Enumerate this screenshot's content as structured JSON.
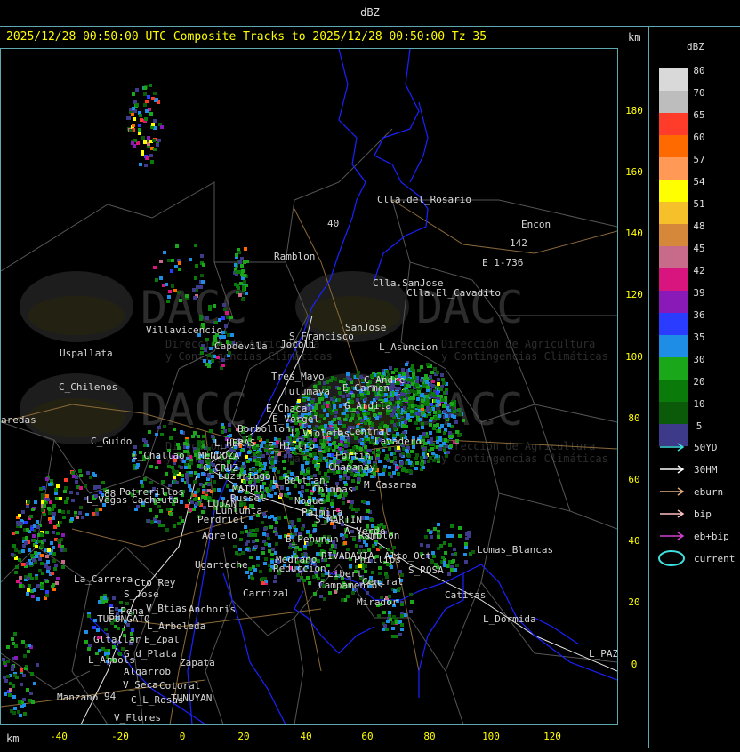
{
  "title": "dBZ",
  "header": "2025/12/28 00:50:00 UTC Composite Tracks to 2025/12/28 00:50:00 Tz 35",
  "km_label": "km",
  "colors": {
    "frame": "#5fa8b0",
    "header": "#ffff00",
    "border_blue": "#1a22ff",
    "roads": "#8a6a3a",
    "white_roads": "#e8e8e8"
  },
  "y_axis": {
    "ticks": [
      "180",
      "160",
      "140",
      "120",
      "100",
      "80",
      "60",
      "40",
      "20",
      "0"
    ]
  },
  "x_axis": {
    "ticks": [
      "-40",
      "-20",
      "0",
      "20",
      "40",
      "60",
      "80",
      "100",
      "120"
    ]
  },
  "legend": {
    "title": "dBZ",
    "scale": [
      {
        "label": "80",
        "color": "#d9d9d9"
      },
      {
        "label": "70",
        "color": "#bdbdbd"
      },
      {
        "label": "65",
        "color": "#ff3b2a"
      },
      {
        "label": "60",
        "color": "#ff6a00"
      },
      {
        "label": "57",
        "color": "#ff9955"
      },
      {
        "label": "54",
        "color": "#ffff00"
      },
      {
        "label": "51",
        "color": "#f6c02a"
      },
      {
        "label": "48",
        "color": "#d6883a"
      },
      {
        "label": "45",
        "color": "#c86b8a"
      },
      {
        "label": "42",
        "color": "#d8157e"
      },
      {
        "label": "39",
        "color": "#8a1ab8"
      },
      {
        "label": "36",
        "color": "#2a3cff"
      },
      {
        "label": "35",
        "color": "#1e8de6"
      },
      {
        "label": "30",
        "color": "#1aa81a"
      },
      {
        "label": "20",
        "color": "#0a7a0a"
      },
      {
        "label": "10",
        "color": "#0a5a0a"
      },
      {
        "label": "5",
        "color": "#3e3a8a"
      }
    ],
    "tracks": [
      {
        "label": "50YD",
        "color": "#40e0e0"
      },
      {
        "label": "30HM",
        "color": "#ffffff"
      },
      {
        "label": "eburn",
        "color": "#e0b080"
      },
      {
        "label": "bip",
        "color": "#ffc0c0"
      },
      {
        "label": "eb+bip",
        "color": "#d040d0"
      }
    ],
    "current_label": "current",
    "current_color": "#40e0e0"
  },
  "watermark": {
    "text": "DACC",
    "sub1": "Dirección de Agricultura",
    "sub2": "y Contingencias Climáticas"
  },
  "places": [
    {
      "name": "Clla.del_Rosario"
    },
    {
      "name": "Encon"
    },
    {
      "name": "142"
    },
    {
      "name": "E_1-736"
    },
    {
      "name": "Ramblon"
    },
    {
      "name": "40"
    },
    {
      "name": "Clla.SanJose"
    },
    {
      "name": "Clla.El_Cavadito"
    },
    {
      "name": "Villavicencio"
    },
    {
      "name": "Capdevila"
    },
    {
      "name": "S_Francisco"
    },
    {
      "name": "SanJose"
    },
    {
      "name": "Jocoli"
    },
    {
      "name": "L_Asuncion"
    },
    {
      "name": "Uspallata"
    },
    {
      "name": "Tres_Mayo"
    },
    {
      "name": "C_Andre"
    },
    {
      "name": "Tulumaya"
    },
    {
      "name": "E_Carmen"
    },
    {
      "name": "C_Chilenos"
    },
    {
      "name": "E_Chacal"
    },
    {
      "name": "E_Vergel"
    },
    {
      "name": "G_Ardila"
    },
    {
      "name": "aredas"
    },
    {
      "name": "Borbollon"
    },
    {
      "name": "L_Violetas"
    },
    {
      "name": "E_Central"
    },
    {
      "name": "C_Guido"
    },
    {
      "name": "L_HERAS"
    },
    {
      "name": "E_Hiltro"
    },
    {
      "name": "Lavadero"
    },
    {
      "name": "E_Challao"
    },
    {
      "name": "MENDOZA"
    },
    {
      "name": "Fortin"
    },
    {
      "name": "G_CRUZ"
    },
    {
      "name": "Luzuriaga"
    },
    {
      "name": "Chapanay"
    },
    {
      "name": "L_Beltran"
    },
    {
      "name": "M_Casarea"
    },
    {
      "name": "Potrerillos"
    },
    {
      "name": "MAIPU"
    },
    {
      "name": "Chimbas"
    },
    {
      "name": "L_Vegas"
    },
    {
      "name": "Cacheuta"
    },
    {
      "name": "Russel"
    },
    {
      "name": "Nogue"
    },
    {
      "name": "LUJAN"
    },
    {
      "name": "Lunlunta"
    },
    {
      "name": "Palmira"
    },
    {
      "name": "Perdriel"
    },
    {
      "name": "S_MARTIN"
    },
    {
      "name": "A_Verde"
    },
    {
      "name": "Agrelo"
    },
    {
      "name": "Ramblon"
    },
    {
      "name": "B_Penunun"
    },
    {
      "name": "Ugarteche"
    },
    {
      "name": "Medrano"
    },
    {
      "name": "RIVADAVIA"
    },
    {
      "name": "Phillips"
    },
    {
      "name": "Reduccion"
    },
    {
      "name": "Alto_Oct"
    },
    {
      "name": "Lomas_Blancas"
    },
    {
      "name": "La_Carrera"
    },
    {
      "name": "Cto_Rey"
    },
    {
      "name": "S_Jose"
    },
    {
      "name": "Carrizal"
    },
    {
      "name": "Libert"
    },
    {
      "name": "S_ROSA"
    },
    {
      "name": "Campamentos"
    },
    {
      "name": "Central"
    },
    {
      "name": "Catitas"
    },
    {
      "name": "V_Btias"
    },
    {
      "name": "Anchoris"
    },
    {
      "name": "E_Pena"
    },
    {
      "name": "TUPUNGATO"
    },
    {
      "name": "Mirador"
    },
    {
      "name": "L_Arboleda"
    },
    {
      "name": "L_Dormida"
    },
    {
      "name": "Gltallar"
    },
    {
      "name": "E_Zpal"
    },
    {
      "name": "G_d_Plata"
    },
    {
      "name": "L_Arbols"
    },
    {
      "name": "Zapata"
    },
    {
      "name": "Algarrob"
    },
    {
      "name": "L_PAZ"
    },
    {
      "name": "V_Seca"
    },
    {
      "name": "Cotoral"
    },
    {
      "name": "TUNUYAN"
    },
    {
      "name": "Manzano"
    },
    {
      "name": "C_L_Rosas"
    },
    {
      "name": "V_Flores"
    },
    {
      "name": "88"
    },
    {
      "name": "94"
    }
  ]
}
